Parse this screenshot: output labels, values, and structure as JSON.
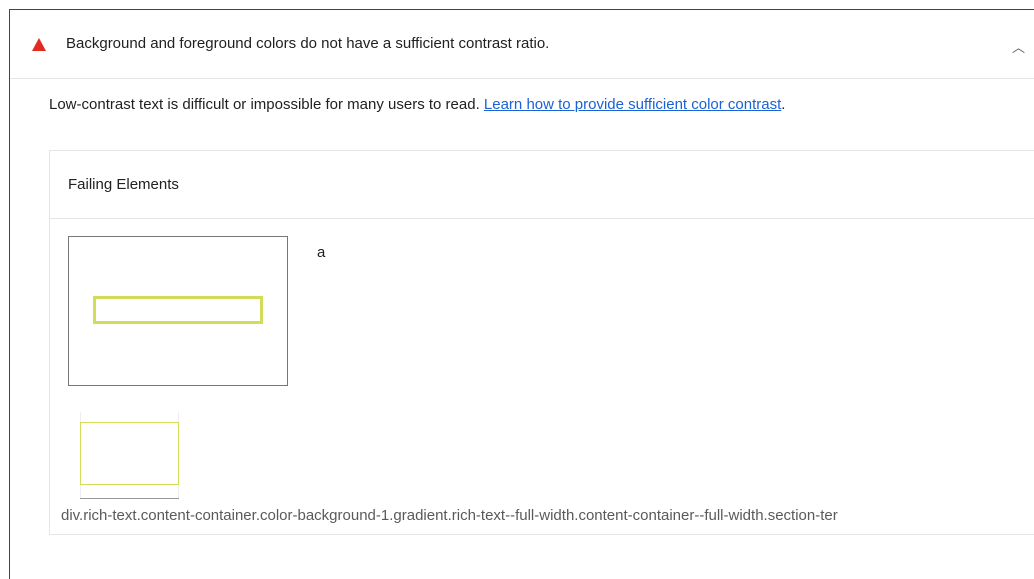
{
  "audit": {
    "title": "Background and foreground colors do not have a sufficient contrast ratio.",
    "status_icon": "fail-triangle-icon",
    "status_color": "#e22b20",
    "expanded_icon": "chevron-up-icon",
    "chevron_glyph": "︿"
  },
  "description": {
    "text": "Low-contrast text is difficult or impossible for many users to read. ",
    "link_text": "Learn how to provide sufficient color contrast",
    "suffix": "."
  },
  "details": {
    "heading": "Failing Elements",
    "items": [
      {
        "snippet": "a",
        "selector": "div.rich-text.content-container.color-background-1.gradient.rich-text--full-width.content-container--full-width.section-ter",
        "highlight_color": "#d1dd59"
      }
    ]
  }
}
